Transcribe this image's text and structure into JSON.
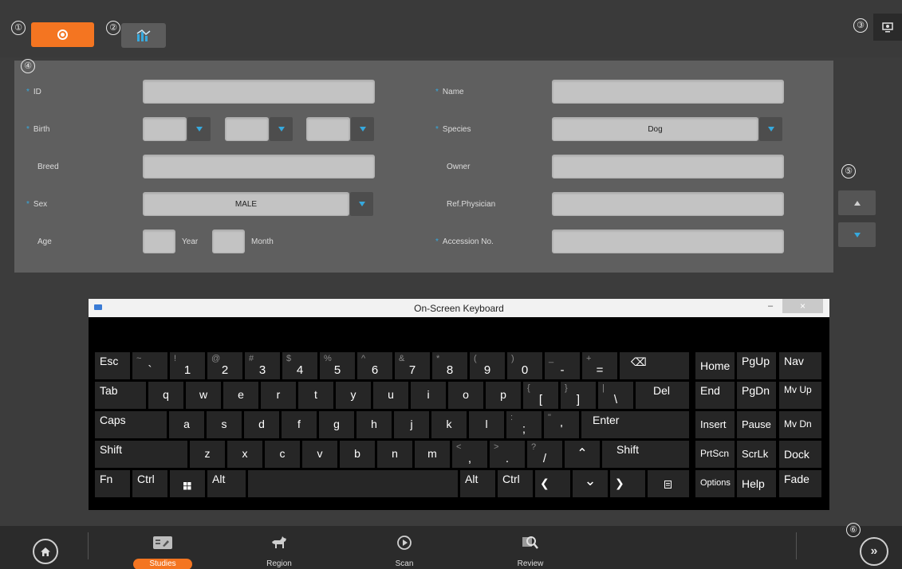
{
  "callouts": [
    "①",
    "②",
    "③",
    "④",
    "⑤",
    "⑥"
  ],
  "toolbar": {
    "new_icon": "add-circle-icon",
    "worklist_icon": "worklist-chart-icon",
    "config_icon": "display-settings-icon"
  },
  "form": {
    "id_label": "ID",
    "name_label": "Name",
    "birth_label": "Birth",
    "species_label": "Species",
    "species_value": "Dog",
    "breed_label": "Breed",
    "owner_label": "Owner",
    "sex_label": "Sex",
    "sex_value": "MALE",
    "refphysician_label": "Ref.Physician",
    "age_label": "Age",
    "year_label": "Year",
    "month_label": "Month",
    "accession_label": "Accession No.",
    "required_marker": "*"
  },
  "osk": {
    "title": "On-Screen Keyboard",
    "minimize": "–",
    "maximize": "□",
    "close": "×"
  },
  "keys": {
    "esc": "Esc",
    "tilde": "~",
    "backtick": "`",
    "k1s": "!",
    "k1": "1",
    "k2s": "@",
    "k2": "2",
    "k3s": "#",
    "k3": "3",
    "k4s": "$",
    "k4": "4",
    "k5s": "%",
    "k5": "5",
    "k6s": "^",
    "k6": "6",
    "k7s": "&",
    "k7": "7",
    "k8s": "*",
    "k8": "8",
    "k9s": "(",
    "k9": "9",
    "k0s": ")",
    "k0": "0",
    "minuss": "_",
    "minus": "-",
    "equals_s": "+",
    "equals": "=",
    "backspace": "⌫",
    "home": "Home",
    "pgup": "PgUp",
    "nav": "Nav",
    "tab": "Tab",
    "q": "q",
    "w": "w",
    "e": "e",
    "r": "r",
    "t": "t",
    "y": "y",
    "u": "u",
    "i": "i",
    "o": "o",
    "p": "p",
    "lbrace": "{",
    "lbracket": "[",
    "rbrace": "}",
    "rbracket": "]",
    "pipe": "|",
    "backslash": "\\",
    "del": "Del",
    "end": "End",
    "pgdn": "PgDn",
    "mvup": "Mv Up",
    "caps": "Caps",
    "a": "a",
    "s": "s",
    "d": "d",
    "f": "f",
    "g": "g",
    "h": "h",
    "j": "j",
    "k": "k",
    "l": "l",
    "colon": ":",
    "semicolon": ";",
    "quote_s": "\"",
    "quote": "'",
    "enter": "Enter",
    "insert": "Insert",
    "pause": "Pause",
    "mvdn": "Mv Dn",
    "shift": "Shift",
    "z": "z",
    "x": "x",
    "c": "c",
    "v": "v",
    "b": "b",
    "n": "n",
    "m": "m",
    "lt": "<",
    "comma": ",",
    "gt": ">",
    "period": ".",
    "question": "?",
    "slash": "/",
    "up": "⌃",
    "prtscn": "PrtScn",
    "scrlk": "ScrLk",
    "dock": "Dock",
    "fn": "Fn",
    "ctrl": "Ctrl",
    "alt": "Alt",
    "left": "❮",
    "down": "⌄",
    "right": "❯",
    "options": "Options",
    "help": "Help",
    "fade": "Fade"
  },
  "bottom_nav": {
    "items": [
      {
        "label": "Studies",
        "icon": "studies-icon",
        "active": true
      },
      {
        "label": "Region",
        "icon": "region-dog-icon",
        "active": false
      },
      {
        "label": "Scan",
        "icon": "scan-play-icon",
        "active": false
      },
      {
        "label": "Review",
        "icon": "review-search-icon",
        "active": false
      }
    ],
    "home_icon": "home-icon",
    "next_icon": "double-chevron-right-icon",
    "next_glyph": "»"
  },
  "colors": {
    "accent": "#f47521",
    "required": "#36a9de",
    "panel": "#5f5f5f",
    "background": "#3c3c3c"
  }
}
